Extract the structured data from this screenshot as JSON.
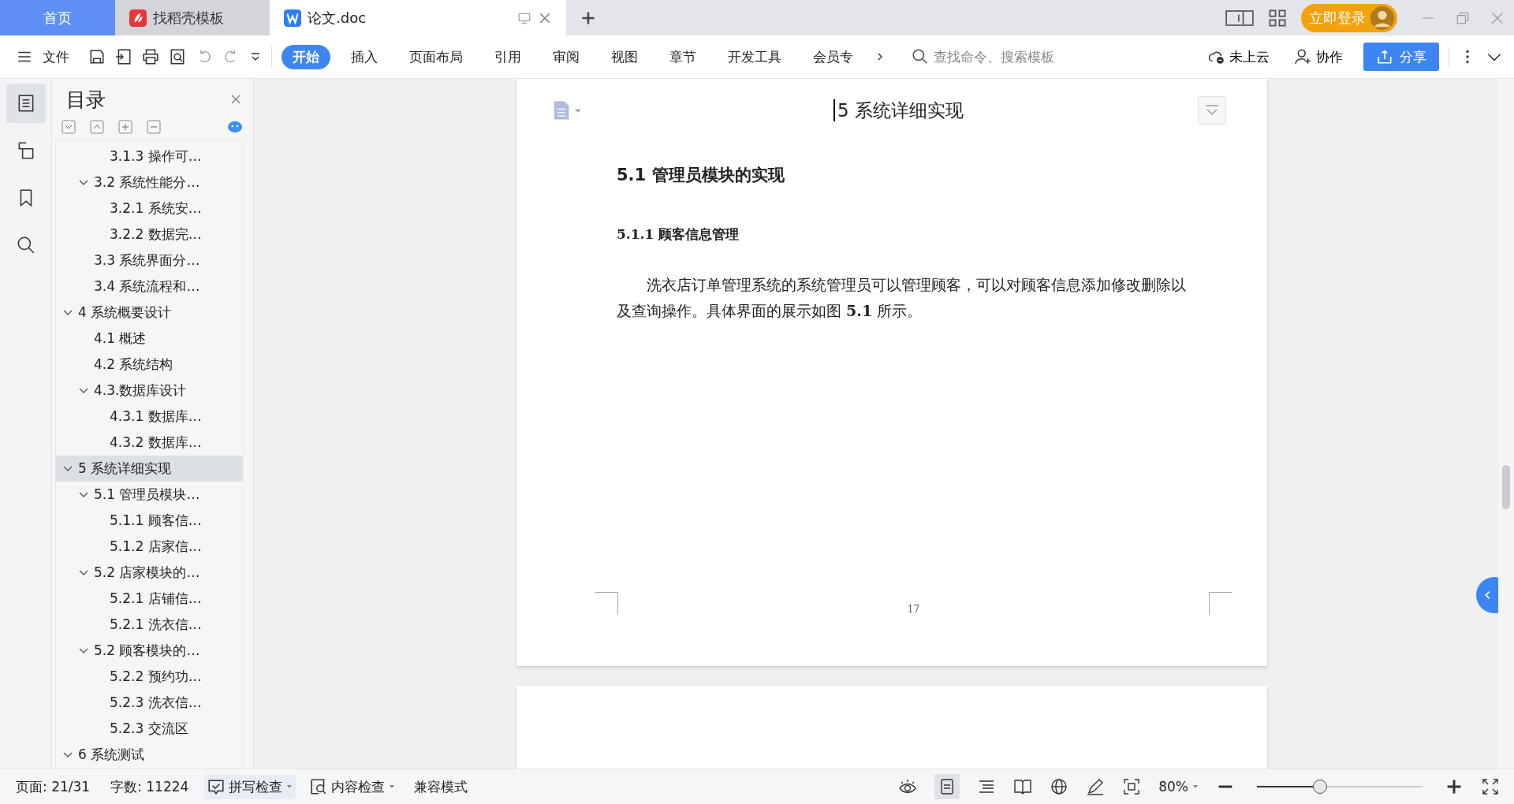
{
  "tabs": [
    {
      "label": "首页",
      "kind": "home",
      "selected": false
    },
    {
      "label": "找稻壳模板",
      "kind": "docer",
      "selected": false
    },
    {
      "label": "论文.doc",
      "kind": "doc",
      "selected": true
    }
  ],
  "account": {
    "login": "立即登录"
  },
  "toolbar": {
    "file_menu": "文件",
    "ribbon_tabs": [
      {
        "label": "开始",
        "selected": true
      },
      {
        "label": "插入",
        "selected": false
      },
      {
        "label": "页面布局",
        "selected": false
      },
      {
        "label": "引用",
        "selected": false
      },
      {
        "label": "审阅",
        "selected": false
      },
      {
        "label": "视图",
        "selected": false
      },
      {
        "label": "章节",
        "selected": false
      },
      {
        "label": "开发工具",
        "selected": false
      },
      {
        "label": "会员专",
        "selected": false
      }
    ],
    "search": {
      "placeholder": "查找命令、搜索模板"
    },
    "cloud": "未上云",
    "collab": "协作",
    "share": "分享"
  },
  "sidebar": {
    "title": "目录",
    "toc": [
      {
        "children": [
          {
            "children": [
              {
                "label": "3.1.3 操作可…"
              }
            ]
          },
          {
            "label": "3.2 系统性能分…",
            "expanded": true,
            "children": [
              {
                "label": "3.2.1  系统安…"
              },
              {
                "label": "3.2.2  数据完…"
              }
            ]
          },
          {
            "label": "3.3 系统界面分…"
          },
          {
            "label": "3.4 系统流程和…"
          }
        ]
      },
      {
        "label": "4 系统概要设计",
        "expanded": true,
        "selected": false,
        "children": [
          {
            "label": "4.1 概述"
          },
          {
            "label": "4.2 系统结构"
          },
          {
            "label": "4.3.数据库设计",
            "expanded": true,
            "children": [
              {
                "label": "4.3.1 数据库…"
              },
              {
                "label": "4.3.2 数据库…"
              }
            ]
          }
        ]
      },
      {
        "label": "5 系统详细实现",
        "expanded": true,
        "selected": true,
        "children": [
          {
            "label": "5.1  管理员模块…",
            "expanded": true,
            "children": [
              {
                "label": "5.1.1  顾客信…"
              },
              {
                "label": "5.1.2  店家信…"
              }
            ]
          },
          {
            "label": "5.2  店家模块的…",
            "expanded": true,
            "children": [
              {
                "label": "5.2.1  店铺信…"
              },
              {
                "label": "5.2.1  洗衣信…"
              }
            ]
          },
          {
            "label": "5.2  顾客模块的…",
            "expanded": true,
            "children": [
              {
                "label": "5.2.2  预约功…"
              },
              {
                "label": "5.2.3  洗衣信…"
              },
              {
                "label": "5.2.3  交流区"
              }
            ]
          }
        ]
      },
      {
        "label": "6 系统测试",
        "expanded": true,
        "selected": false
      }
    ]
  },
  "document": {
    "header": "5 系统详细实现",
    "heading": "5.1  管理员模块的实现",
    "subheading": "5.1.1  顾客信息管理",
    "paragraph": "洗衣店订单管理系统的系统管理员可以管理顾客，可以对顾客信息添加修改删除以及查询操作。具体界面的展示如图 **5.1** 所示。",
    "page_number": "17"
  },
  "status_bar": {
    "page": "页面: 21/31",
    "words": "字数: 11224",
    "spell_check": "拼写检查",
    "content_check": "内容检查",
    "compat": "兼容模式",
    "zoom": "80%",
    "zoom_slider": {
      "level": 0.38
    }
  }
}
